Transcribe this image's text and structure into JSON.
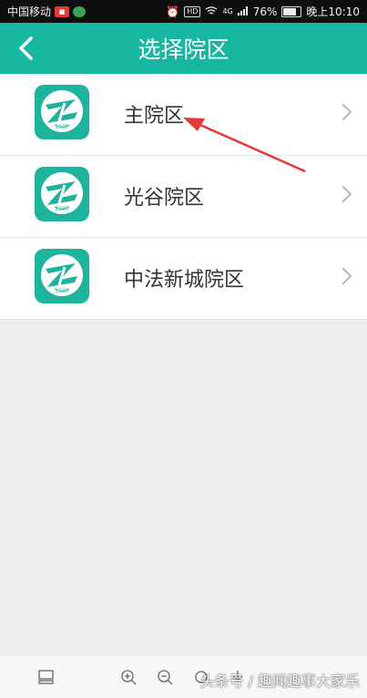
{
  "statusbar": {
    "carrier": "中国移动",
    "signal": "4G",
    "battery": "76%",
    "time": "晚上10:10",
    "hd": "HD"
  },
  "header": {
    "title": "选择院区",
    "back_icon": "chevron-left-icon"
  },
  "campuses": [
    {
      "name": "主院区",
      "logo_caption": "1930"
    },
    {
      "name": "光谷院区",
      "logo_caption": "1930"
    },
    {
      "name": "中法新城院区",
      "logo_caption": "1930"
    }
  ],
  "colors": {
    "accent": "#16b6a1",
    "annotation_arrow": "#e53935"
  },
  "watermark": "头条号 / 趣闻趣事大家乐"
}
